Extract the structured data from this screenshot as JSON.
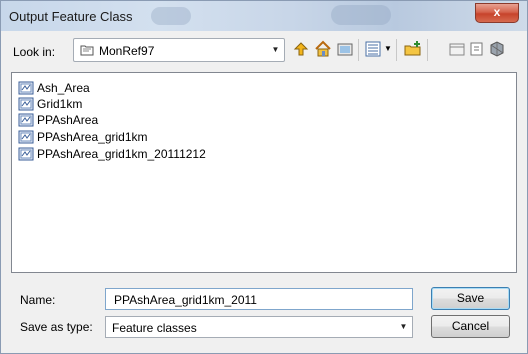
{
  "window": {
    "title": "Output Feature Class",
    "close_glyph": "x"
  },
  "toolbar": {
    "look_in_label": "Look in:",
    "look_in_value": "MonRef97",
    "icons": [
      "up-one-level-icon",
      "home-icon",
      "connect-folder-icon",
      "view-menu-icon",
      "new-item-icon",
      "new-folder-icon",
      "refresh-icon",
      "options-icon"
    ]
  },
  "files": [
    {
      "name": "Ash_Area",
      "icon": "feature-class-icon"
    },
    {
      "name": "Grid1km",
      "icon": "feature-class-icon"
    },
    {
      "name": "PPAshArea",
      "icon": "feature-class-icon"
    },
    {
      "name": "PPAshArea_grid1km",
      "icon": "feature-class-icon"
    },
    {
      "name": "PPAshArea_grid1km_20111212",
      "icon": "feature-class-icon"
    }
  ],
  "form": {
    "name_label": "Name:",
    "name_value": "PPAshArea_grid1km_2011",
    "type_label": "Save as type:",
    "type_value": "Feature classes"
  },
  "buttons": {
    "save": "Save",
    "cancel": "Cancel"
  },
  "colors": {
    "titlebar": "#c7d7ea",
    "close_button": "#c7432b",
    "default_button_border": "#3c7fb1"
  }
}
